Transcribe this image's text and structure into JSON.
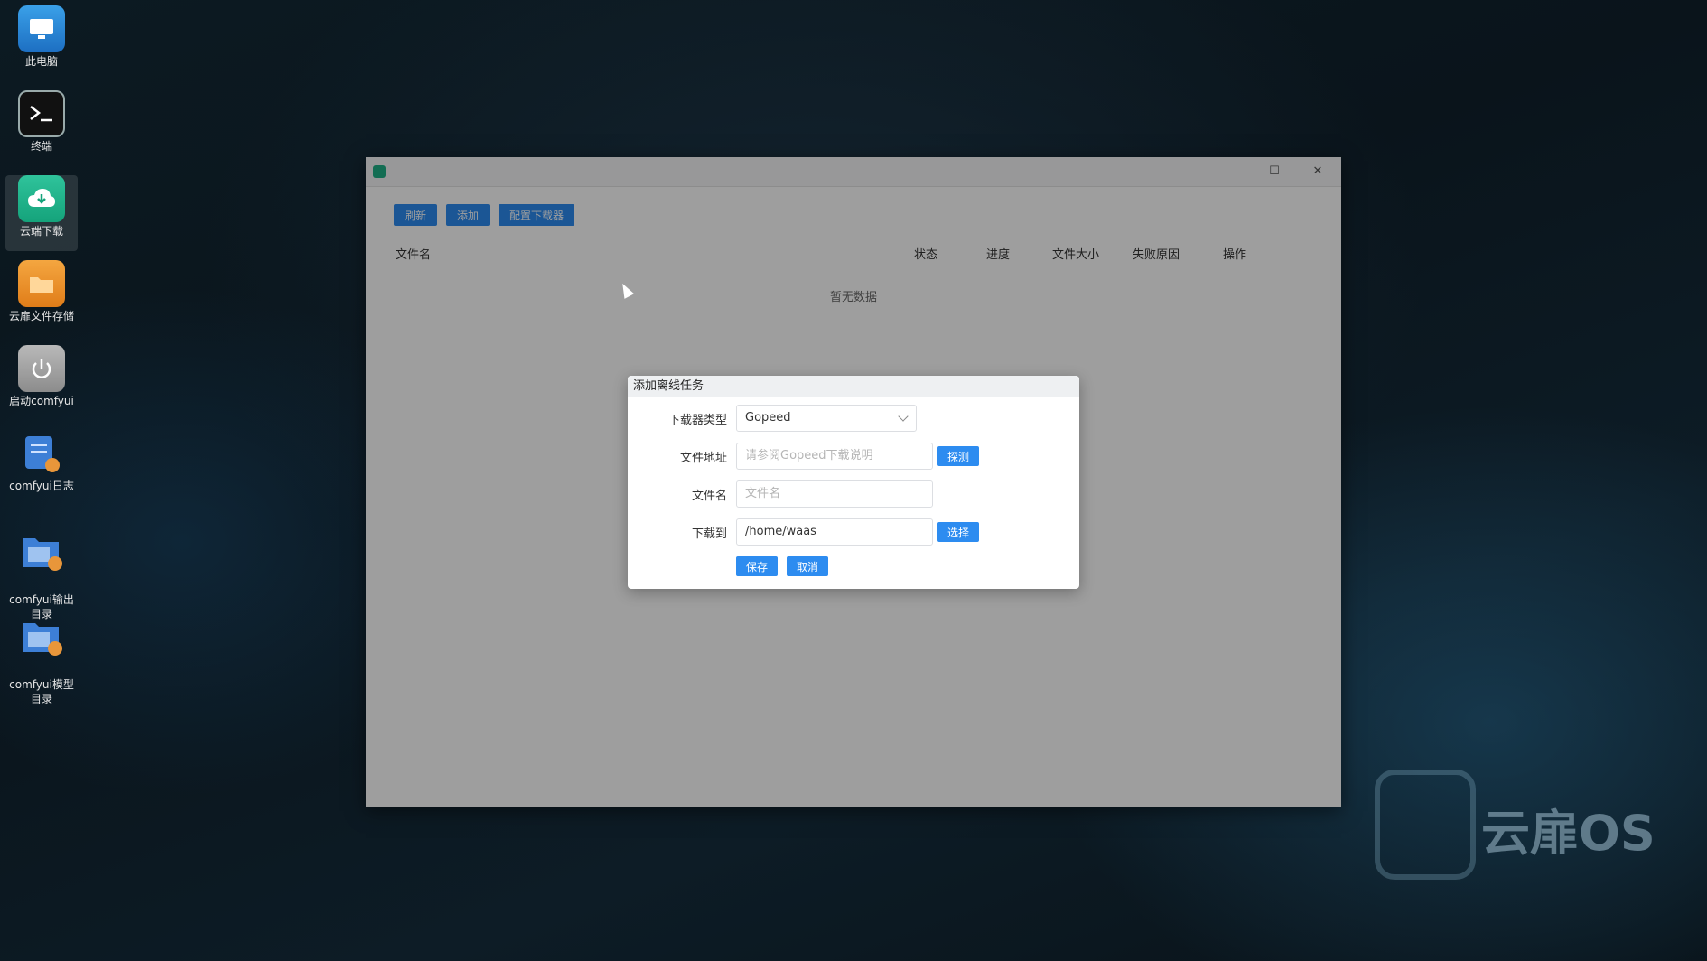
{
  "desktop": {
    "icons": [
      {
        "label": "此电脑",
        "icon": "computer-icon"
      },
      {
        "label": "终端",
        "icon": "terminal-icon"
      },
      {
        "label": "云端下载",
        "icon": "cloud-download-icon"
      },
      {
        "label": "云扉文件存储",
        "icon": "folder-icon"
      },
      {
        "label": "启动comfyui",
        "icon": "power-icon"
      },
      {
        "label": "comfyui日志",
        "icon": "log-file-icon"
      },
      {
        "label": "comfyui输出\n目录",
        "icon": "output-folder-icon"
      },
      {
        "label": "comfyui模型\n目录",
        "icon": "model-folder-icon"
      }
    ],
    "brand": "云扉OS"
  },
  "window": {
    "toolbar": {
      "refresh": "刷新",
      "add": "添加",
      "config": "配置下载器"
    },
    "table": {
      "columns": [
        "文件名",
        "状态",
        "进度",
        "文件大小",
        "失败原因",
        "操作"
      ],
      "empty_text": "暂无数据"
    }
  },
  "dialog": {
    "title": "添加离线任务",
    "downloader_type_label": "下载器类型",
    "downloader_type_value": "Gopeed",
    "url_label": "文件地址",
    "url_placeholder": "请参阅Gopeed下载说明",
    "detect_button": "探测",
    "filename_label": "文件名",
    "filename_placeholder": "文件名",
    "download_to_label": "下载到",
    "download_to_value": "/home/waas",
    "choose_button": "选择",
    "save_button": "保存",
    "cancel_button": "取消"
  }
}
